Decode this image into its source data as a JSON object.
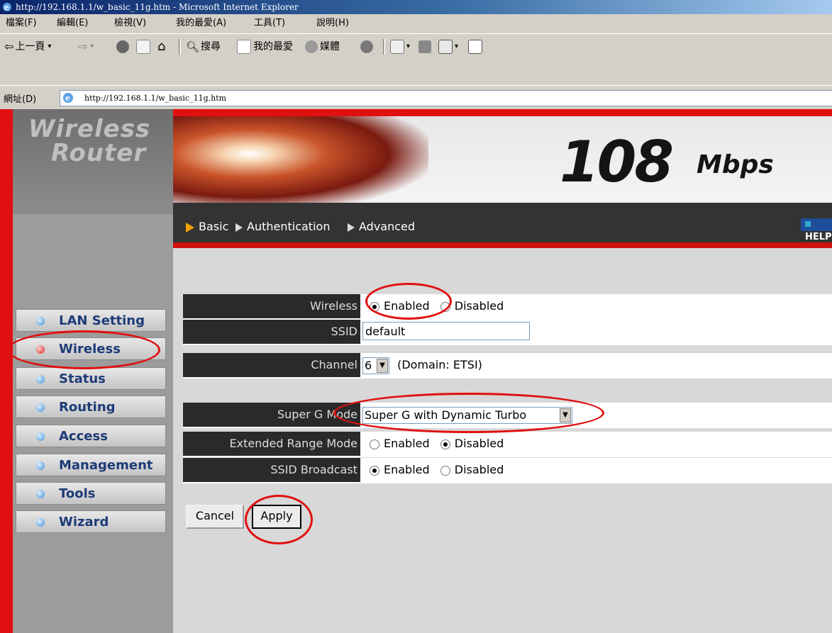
{
  "window": {
    "title": "http://192.168.1.1/w_basic_11g.htm - Microsoft Internet Explorer"
  },
  "menubar": {
    "items": [
      "檔案(F)",
      "編輯(E)",
      "檢視(V)",
      "我的最愛(A)",
      "工具(T)",
      "說明(H)"
    ]
  },
  "toolbar": {
    "back": "上一頁",
    "search": "搜尋",
    "favorites": "我的最愛",
    "media": "媒體"
  },
  "address": {
    "label": "網址(D)",
    "url": "http://192.168.1.1/w_basic_11g.htm"
  },
  "logo": {
    "line1": "Wireless",
    "line2": "Router"
  },
  "banner": {
    "speed": "108",
    "unit": "Mbps"
  },
  "nav": {
    "basic": "Basic",
    "auth": "Authentication",
    "advanced": "Advanced",
    "help": "HELP"
  },
  "sidebar": {
    "items": [
      {
        "label": "LAN Setting",
        "active": false
      },
      {
        "label": "Wireless",
        "active": true
      },
      {
        "label": "Status",
        "active": false
      },
      {
        "label": "Routing",
        "active": false
      },
      {
        "label": "Access",
        "active": false
      },
      {
        "label": "Management",
        "active": false
      },
      {
        "label": "Tools",
        "active": false
      },
      {
        "label": "Wizard",
        "active": false
      }
    ]
  },
  "form": {
    "wireless": {
      "label": "Wireless",
      "opt1": "Enabled",
      "opt2": "Disabled",
      "selected": "Enabled"
    },
    "ssid": {
      "label": "SSID",
      "value": "default"
    },
    "channel": {
      "label": "Channel",
      "value": "6",
      "domain": "(Domain: ETSI)"
    },
    "superg": {
      "label": "Super G Mode",
      "value": "Super G with Dynamic Turbo"
    },
    "extrange": {
      "label": "Extended Range Mode",
      "opt1": "Enabled",
      "opt2": "Disabled",
      "selected": "Disabled"
    },
    "ssidbc": {
      "label": "SSID Broadcast",
      "opt1": "Enabled",
      "opt2": "Disabled",
      "selected": "Enabled"
    }
  },
  "buttons": {
    "cancel": "Cancel",
    "apply": "Apply"
  },
  "colors": {
    "accent_red": "#e01010",
    "sidebar_text": "#1e3b78",
    "label_bg": "#2a2a2a"
  }
}
